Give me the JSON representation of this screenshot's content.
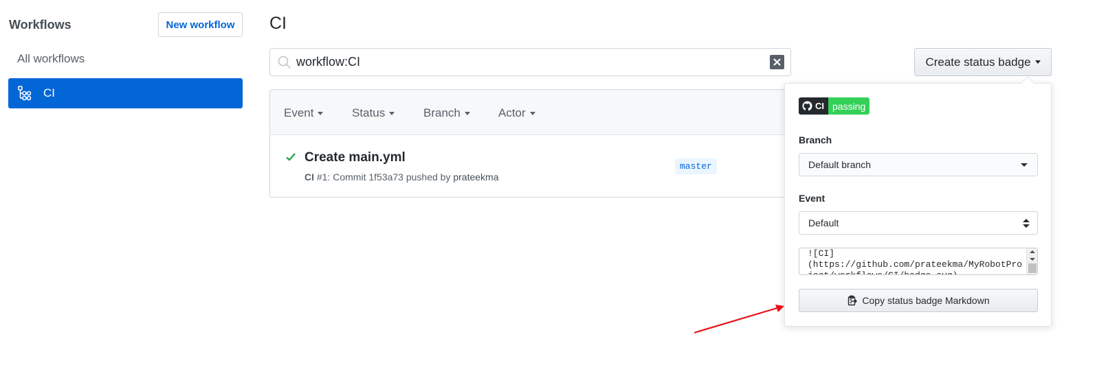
{
  "sidebar": {
    "title": "Workflows",
    "new_workflow_label": "New workflow",
    "items": [
      {
        "label": "All workflows"
      },
      {
        "label": "CI",
        "active": true,
        "icon": "workflow-icon"
      }
    ]
  },
  "main": {
    "title": "CI",
    "search": {
      "value": "workflow:CI",
      "placeholder": ""
    },
    "create_badge_label": "Create status badge",
    "filters": [
      "Event",
      "Status",
      "Branch",
      "Actor"
    ],
    "runs": [
      {
        "status": "success",
        "title": "Create main.yml",
        "workflow": "CI",
        "number": "#1",
        "meta_text": ": Commit 1f53a73 pushed by",
        "actor": "prateekma",
        "branch": "master"
      }
    ]
  },
  "badge_popover": {
    "badge_left": "CI",
    "badge_right": "passing",
    "branch_label": "Branch",
    "branch_value": "Default branch",
    "event_label": "Event",
    "event_value": "Default",
    "markdown": "![CI](https://github.com/prateekma/MyRobotProject/workflows/CI/badge.svg)",
    "copy_label": "Copy status badge Markdown"
  },
  "colors": {
    "accent": "#0366d6",
    "success": "#28a745",
    "badge_passing": "#34d058",
    "annotation": "#e8111b"
  }
}
